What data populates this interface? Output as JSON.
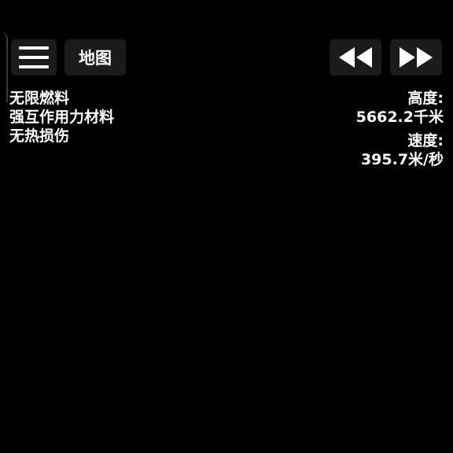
{
  "toolbar": {
    "menu_icon": "hamburger-menu-icon",
    "map_label": "地图",
    "rewind_icon": "rewind-icon",
    "fast_forward_icon": "fast-forward-icon"
  },
  "cheats": [
    "无限燃料",
    "强互作用力材料",
    "无热损伤"
  ],
  "telemetry": {
    "altitude_label": "高度:",
    "altitude_value": "5662.2千米",
    "velocity_label": "速度:",
    "velocity_value": "395.7米/秒"
  },
  "colors": {
    "background": "#000000",
    "button_bg": "#1b1b1b",
    "text": "#ffffff"
  }
}
